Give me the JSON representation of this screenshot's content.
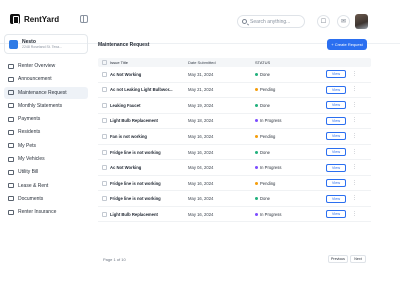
{
  "app": {
    "name": "RentYard"
  },
  "search": {
    "placeholder": "Search anything..."
  },
  "house": {
    "name": "Nesto",
    "address": "2248 Roseland St. Texa..."
  },
  "sidebar": {
    "items": [
      {
        "label": "Renter Overview"
      },
      {
        "label": "Announcement"
      },
      {
        "label": "Maintenance Request",
        "active": true
      },
      {
        "label": "Monthly Statements"
      },
      {
        "label": "Payments"
      },
      {
        "label": "Residents"
      },
      {
        "label": "My Pets"
      },
      {
        "label": "My Vehicles"
      },
      {
        "label": "Utility Bill"
      },
      {
        "label": "Lease & Rent"
      },
      {
        "label": "Documents"
      },
      {
        "label": "Renter Insurance"
      }
    ]
  },
  "main": {
    "title": "Maintenance Request",
    "create_label": "+ Create Request"
  },
  "table": {
    "columns": [
      "Issue Title",
      "Date Submitted",
      "STATUS"
    ],
    "view_label": "View",
    "rows": [
      {
        "title": "Ac Not Working",
        "date": "May 31, 2024",
        "status": "Done"
      },
      {
        "title": "Ac not Leaking Light Bulbwor...",
        "date": "May 21, 2024",
        "status": "Pending"
      },
      {
        "title": "Leaking Faucet",
        "date": "May 19, 2024",
        "status": "Done"
      },
      {
        "title": "Light Bulb Replacement",
        "date": "May 18, 2024",
        "status": "In Progress"
      },
      {
        "title": "Fan is not working",
        "date": "May 16, 2024",
        "status": "Pending"
      },
      {
        "title": "Fridge line is not working",
        "date": "May 16, 2024",
        "status": "Done"
      },
      {
        "title": "Ac Not Working",
        "date": "May 04, 2024",
        "status": "In Progress"
      },
      {
        "title": "Fridge line is not working",
        "date": "May 16, 2024",
        "status": "Pending"
      },
      {
        "title": "Fridge line is not working",
        "date": "May 16, 2024",
        "status": "Done"
      },
      {
        "title": "Light Bulb Replacement",
        "date": "May 16, 2024",
        "status": "In Progress"
      }
    ]
  },
  "pagination": {
    "text": "Page 1 of 10",
    "prev_label": "Previous",
    "next_label": "Next"
  },
  "status_colors": {
    "Done": "#22b07d",
    "Pending": "#f59e0b",
    "In Progress": "#7c4dff"
  },
  "colors": {
    "accent": "#2b6ff0"
  }
}
